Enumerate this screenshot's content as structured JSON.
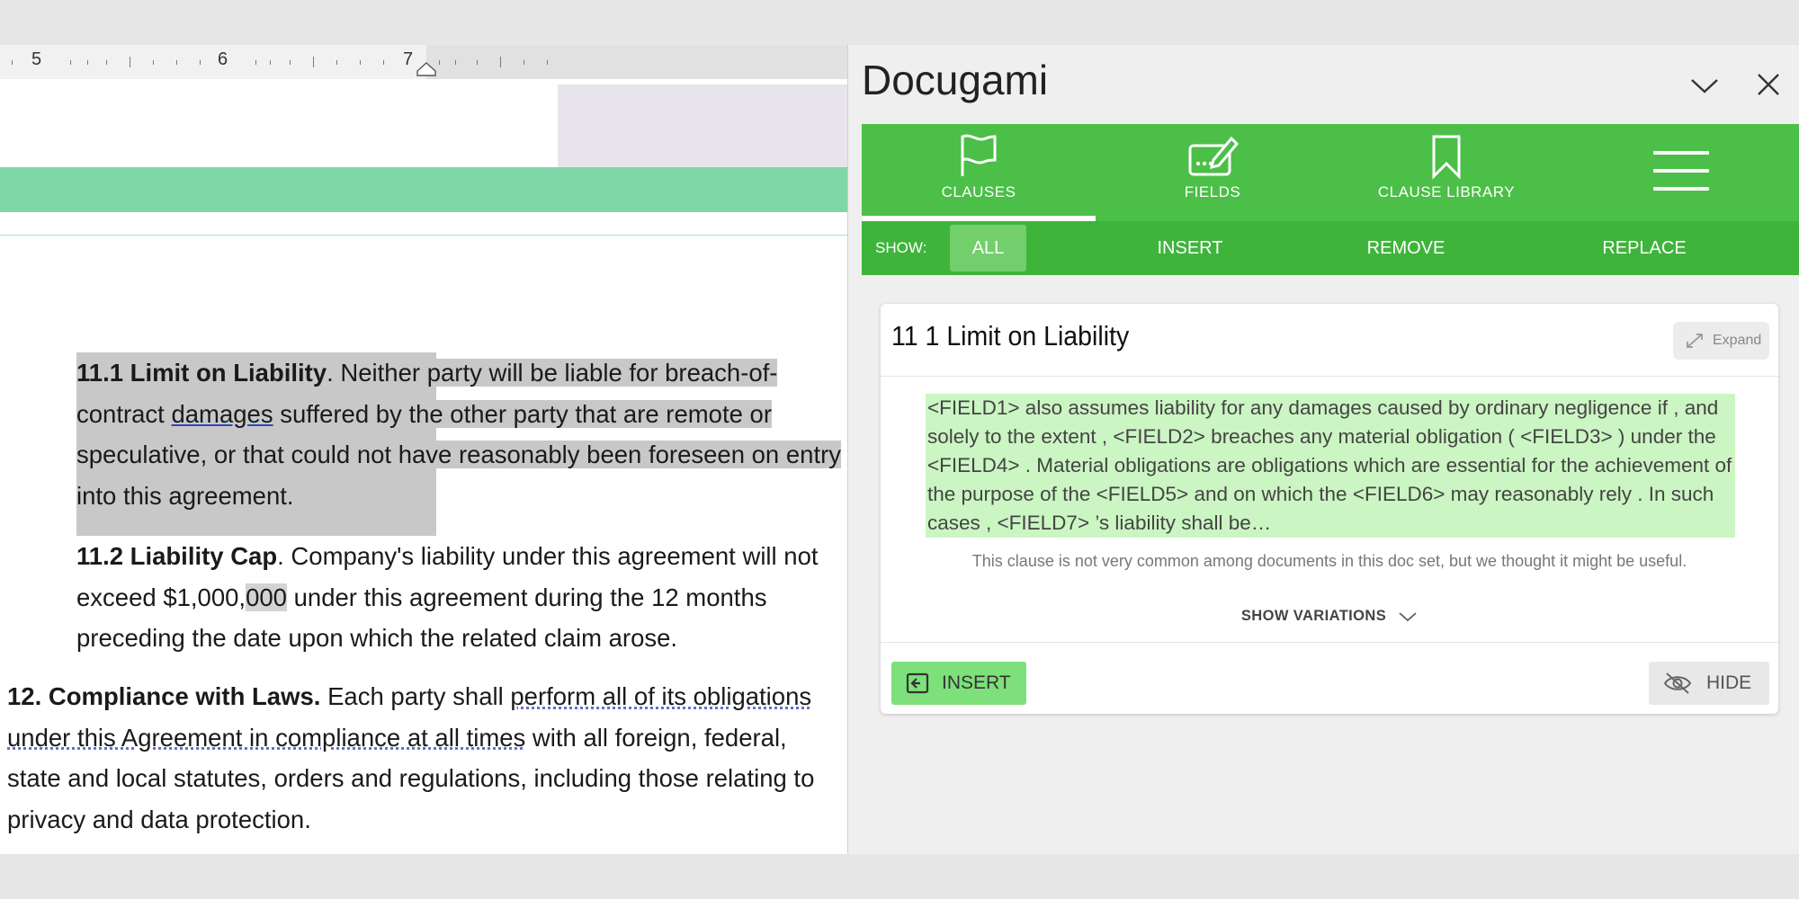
{
  "ruler": {
    "numbers": [
      "5",
      "6",
      "7"
    ]
  },
  "document": {
    "para_11_1": {
      "heading": "11.1 Limit on Liability",
      "text_a": ". Neither party will be liable for breach-of-contract ",
      "link": "damages",
      "text_b": " suffered by the other party that are remote or speculative, or that could not have reasonably been foreseen on entry into this agreement."
    },
    "para_11_2": {
      "heading": "11.2 Liability Cap",
      "text_a": ".  Company's liability under this agreement will not exceed $1,000,",
      "chip": "000",
      "text_b": " under this agreement during the 12 months preceding the date upon which the related claim arose."
    },
    "para_12": {
      "heading": "12. Compliance with Laws.",
      "text_a": " Each party shall ",
      "dotted": "perform all of its obligations under this Agreement in compliance at all times",
      "text_b": " with all foreign, federal, state and local statutes, orders and regulations, including those relating to privacy and data protection."
    }
  },
  "panel": {
    "title": "Docugami",
    "tabs": [
      {
        "label": "CLAUSES",
        "icon": "flag-icon",
        "active": true
      },
      {
        "label": "FIELDS",
        "icon": "edit-field-icon"
      },
      {
        "label": "CLAUSE LIBRARY",
        "icon": "bookmark-icon"
      }
    ],
    "show_label": "SHOW:",
    "filters": [
      "ALL",
      "INSERT",
      "REMOVE",
      "REPLACE"
    ],
    "active_filter": "ALL",
    "card": {
      "title": "11 1 Limit on Liability",
      "expand_label": "Expand",
      "clause_text": "<FIELD1> also assumes liability for any damages caused by ordinary negligence if , and solely to the extent , <FIELD2> breaches any material obligation ( <FIELD3> ) under the <FIELD4> . Material obligations are obligations which are essential for the achievement of the purpose of the <FIELD5> and on which the <FIELD6> may reasonably rely . In such cases , <FIELD7> ’s liability shall be…",
      "note": "This clause is not very common among documents in this doc set, but we thought it might be useful.",
      "show_variations": "SHOW VARIATIONS",
      "insert_label": "INSERT",
      "hide_label": "HIDE"
    }
  },
  "colors": {
    "brand_green": "#4bbf47",
    "clause_highlight": "#cbf5c2",
    "insert_button": "#7ee07a"
  }
}
